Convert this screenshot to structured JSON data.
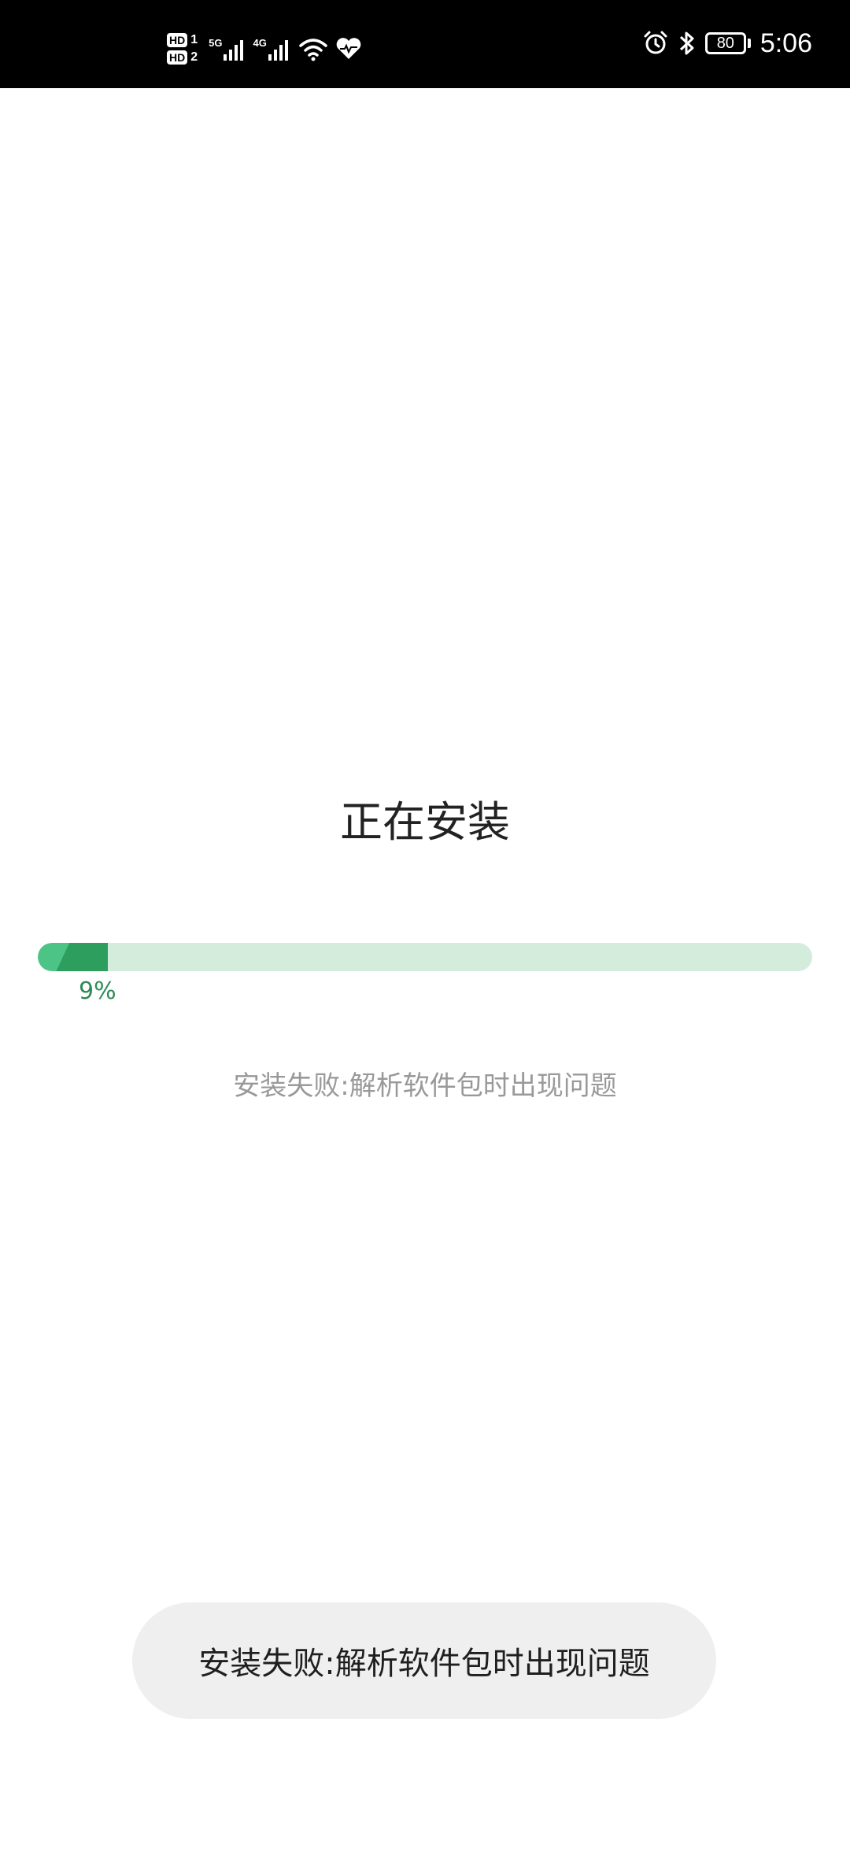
{
  "status_bar": {
    "sim1_label": "HD",
    "sim1_num": "1",
    "sim2_label": "HD",
    "sim2_num": "2",
    "net1": "5G",
    "net2": "4G",
    "battery_level": "80",
    "time": "5:06",
    "icons": [
      "signal-icon",
      "wifi-icon",
      "health-icon",
      "alarm-icon",
      "bluetooth-icon",
      "battery-icon"
    ]
  },
  "install": {
    "title": "正在安装",
    "progress_fraction": 0.09,
    "progress_label": "9%",
    "error_message": "安装失败:解析软件包时出现问题"
  },
  "toast": {
    "message": "安装失败:解析软件包时出现问题"
  },
  "colors": {
    "accent": "#2e9e5e",
    "accent_light": "#4cc486",
    "track": "#d3ecdc",
    "percent_text": "#2e8b57"
  }
}
